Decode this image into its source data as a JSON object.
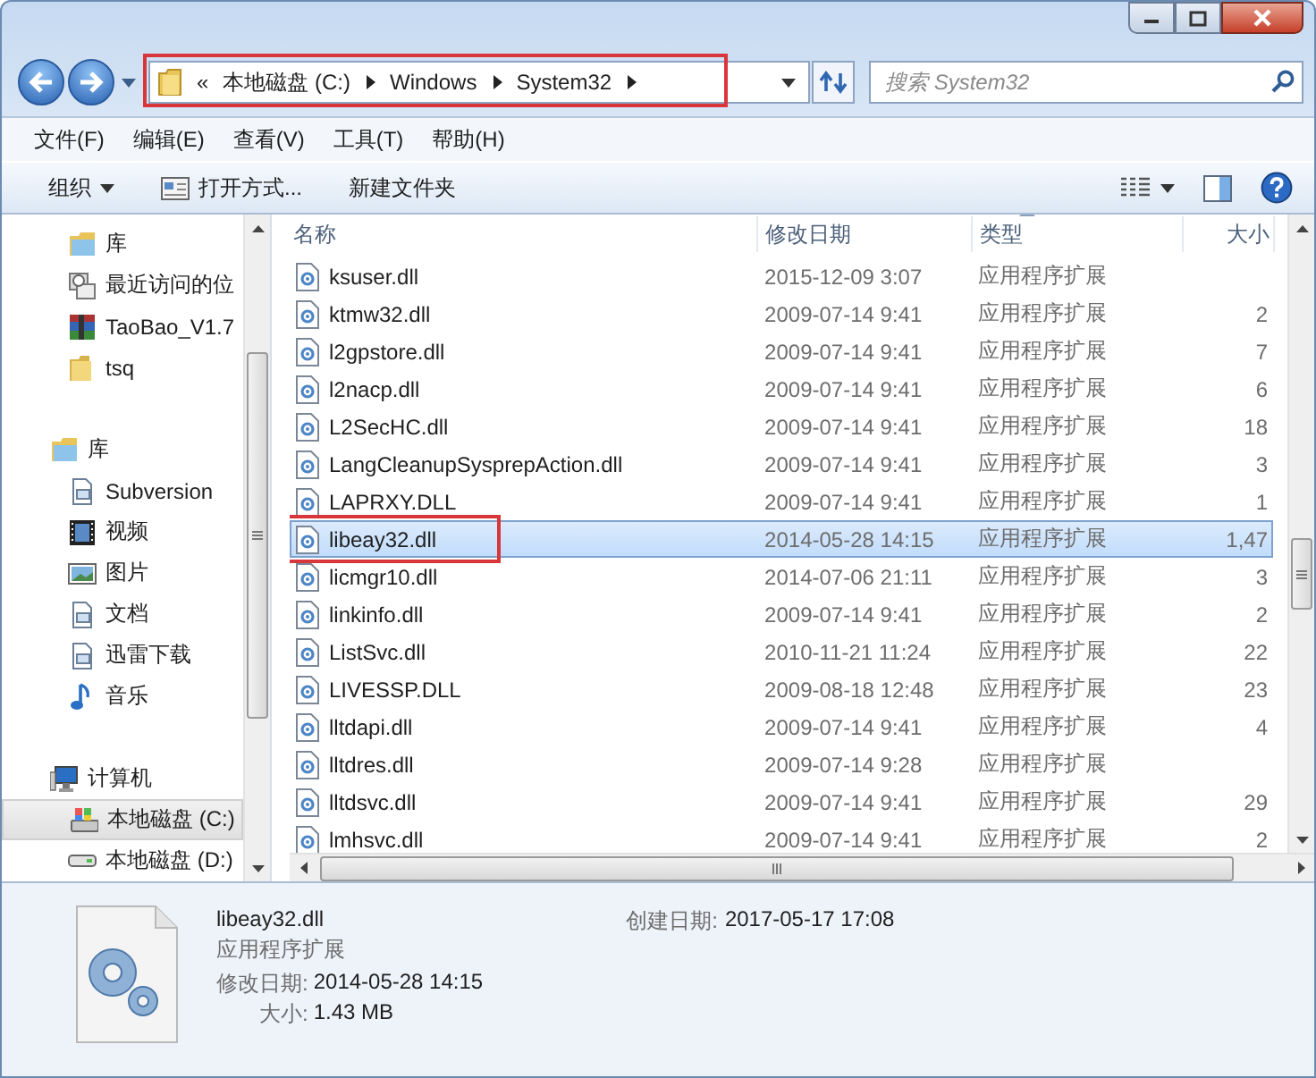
{
  "address_bar": {
    "overflow": "«",
    "segments": [
      "本地磁盘 (C:)",
      "Windows",
      "System32"
    ],
    "highlighted": true
  },
  "search": {
    "placeholder": "搜索 System32"
  },
  "menu": [
    "文件(F)",
    "编辑(E)",
    "查看(V)",
    "工具(T)",
    "帮助(H)"
  ],
  "toolbar": [
    {
      "label": "组织",
      "kind": "dropdown"
    },
    {
      "label": "打开方式...",
      "kind": "open"
    },
    {
      "label": "新建文件夹",
      "kind": "plain"
    }
  ],
  "nav": [
    {
      "children": [
        {
          "label": "库",
          "kind": "library",
          "selected": false
        },
        {
          "label": "最近访问的位",
          "kind": "recent",
          "selected": false
        },
        {
          "label": "TaoBao_V1.7",
          "kind": "archive",
          "selected": false
        },
        {
          "label": "tsq",
          "kind": "folder",
          "selected": false
        }
      ]
    },
    {
      "label": "库",
      "kind": "library",
      "children": [
        {
          "label": "Subversion",
          "kind": "doc",
          "selected": false
        },
        {
          "label": "视频",
          "kind": "video",
          "selected": false
        },
        {
          "label": "图片",
          "kind": "picture",
          "selected": false
        },
        {
          "label": "文档",
          "kind": "doc",
          "selected": false
        },
        {
          "label": "迅雷下载",
          "kind": "doc",
          "selected": false
        },
        {
          "label": "音乐",
          "kind": "music",
          "selected": false
        }
      ]
    },
    {
      "label": "计算机",
      "kind": "computer",
      "children": [
        {
          "label": "本地磁盘 (C:)",
          "kind": "system-drive",
          "selected": true
        },
        {
          "label": "本地磁盘 (D:)",
          "kind": "drive",
          "selected": false
        }
      ]
    }
  ],
  "table": {
    "columns": [
      {
        "label": "名称",
        "sorted": false
      },
      {
        "label": "修改日期",
        "sorted": false
      },
      {
        "label": "类型",
        "sorted": true
      },
      {
        "label": "大小",
        "sorted": false
      }
    ],
    "rows": [
      {
        "name": "ksuser.dll",
        "modified": "2015-12-09 3:07",
        "type": "应用程序扩展",
        "selected": false,
        "highlighted": false
      },
      {
        "name": "ktmw32.dll",
        "modified": "2009-07-14 9:41",
        "type": "应用程序扩展",
        "size": "2",
        "selected": false,
        "highlighted": false
      },
      {
        "name": "l2gpstore.dll",
        "modified": "2009-07-14 9:41",
        "type": "应用程序扩展",
        "size": "7",
        "selected": false,
        "highlighted": false
      },
      {
        "name": "l2nacp.dll",
        "modified": "2009-07-14 9:41",
        "type": "应用程序扩展",
        "size": "6",
        "selected": false,
        "highlighted": false
      },
      {
        "name": "L2SecHC.dll",
        "modified": "2009-07-14 9:41",
        "type": "应用程序扩展",
        "size": "18",
        "selected": false,
        "highlighted": false
      },
      {
        "name": "LangCleanupSysprepAction.dll",
        "modified": "2009-07-14 9:41",
        "type": "应用程序扩展",
        "size": "3",
        "selected": false,
        "highlighted": false
      },
      {
        "name": "LAPRXY.DLL",
        "modified": "2009-07-14 9:41",
        "type": "应用程序扩展",
        "size": "1",
        "selected": false,
        "highlighted": false
      },
      {
        "name": "libeay32.dll",
        "modified": "2014-05-28 14:15",
        "type": "应用程序扩展",
        "size": "1,47",
        "selected": true,
        "highlighted": true
      },
      {
        "name": "licmgr10.dll",
        "modified": "2014-07-06 21:11",
        "type": "应用程序扩展",
        "size": "3",
        "selected": false,
        "highlighted": false
      },
      {
        "name": "linkinfo.dll",
        "modified": "2009-07-14 9:41",
        "type": "应用程序扩展",
        "size": "2",
        "selected": false,
        "highlighted": false
      },
      {
        "name": "ListSvc.dll",
        "modified": "2010-11-21 11:24",
        "type": "应用程序扩展",
        "size": "22",
        "selected": false,
        "highlighted": false
      },
      {
        "name": "LIVESSP.DLL",
        "modified": "2009-08-18 12:48",
        "type": "应用程序扩展",
        "size": "23",
        "selected": false,
        "highlighted": false
      },
      {
        "name": "lltdapi.dll",
        "modified": "2009-07-14 9:41",
        "type": "应用程序扩展",
        "size": "4",
        "selected": false,
        "highlighted": false
      },
      {
        "name": "lltdres.dll",
        "modified": "2009-07-14 9:28",
        "type": "应用程序扩展",
        "selected": false,
        "highlighted": false
      },
      {
        "name": "lltdsvc.dll",
        "modified": "2009-07-14 9:41",
        "type": "应用程序扩展",
        "size": "29",
        "selected": false,
        "highlighted": false
      },
      {
        "name": "lmhsvc.dll",
        "modified": "2009-07-14 9:41",
        "type": "应用程序扩展",
        "size": "2",
        "selected": false,
        "highlighted": false
      }
    ]
  },
  "details": {
    "name": "libeay32.dll",
    "type": "应用程序扩展",
    "fields": [
      {
        "label": "修改日期:",
        "value": "2014-05-28 14:15"
      },
      {
        "label": "大小:",
        "value": "1.43 MB"
      }
    ],
    "side_fields": [
      {
        "label": "创建日期:",
        "value": "2017-05-17 17:08"
      }
    ]
  }
}
